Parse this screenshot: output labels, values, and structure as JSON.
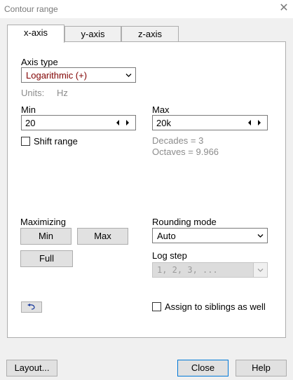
{
  "window": {
    "title": "Contour range",
    "close_glyph": "✕"
  },
  "tabs": [
    {
      "label": "x-axis",
      "active": true
    },
    {
      "label": "y-axis",
      "active": false
    },
    {
      "label": "z-axis",
      "active": false
    }
  ],
  "axis_type": {
    "label": "Axis type",
    "selected": "Logarithmic (+)",
    "selected_color": "#800000",
    "units_label": "Units:",
    "units_value": "Hz"
  },
  "range": {
    "min_label": "Min",
    "min_value": "20",
    "max_label": "Max",
    "max_value": "20k",
    "shift_range_label": "Shift range",
    "shift_range_checked": false,
    "decades_text": "Decades = 3",
    "octaves_text": "Octaves = 9.966"
  },
  "maximizing": {
    "label": "Maximizing",
    "min_button": "Min",
    "max_button": "Max",
    "full_button": "Full"
  },
  "rounding": {
    "label": "Rounding mode",
    "selected": "Auto",
    "log_step_label": "Log step",
    "log_step_value": "1, 2, 3, ...",
    "log_step_enabled": false
  },
  "undo": {
    "icon": "undo-arrow-icon"
  },
  "assign_siblings": {
    "label": "Assign to siblings as well",
    "checked": false
  },
  "footer": {
    "layout_button": "Layout...",
    "close_button": "Close",
    "help_button": "Help"
  },
  "colors": {
    "accent": "#0078d7",
    "disabled_text": "#8c8c8c"
  }
}
